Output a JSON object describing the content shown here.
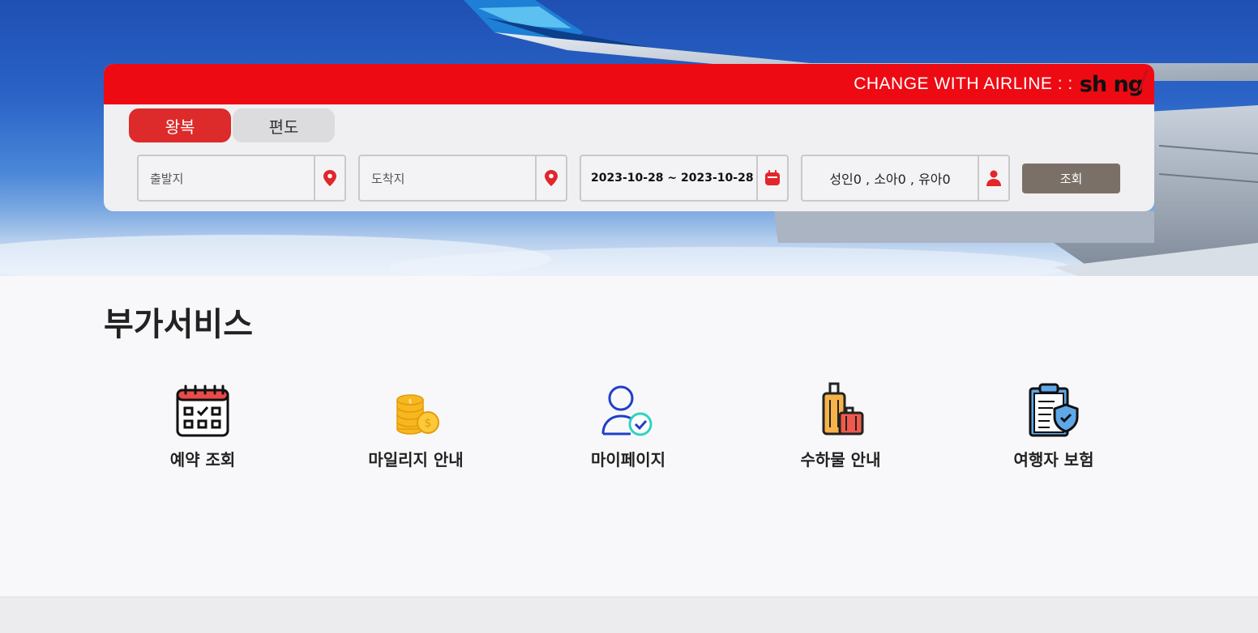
{
  "search_panel": {
    "tagline": "CHANGE WITH AIRLINE : :",
    "brand": "sh ng",
    "trip_types": {
      "round_trip": "왕복",
      "one_way": "편도",
      "selected": "round_trip"
    },
    "departure": {
      "placeholder": "출발지",
      "icon": "map-pin-icon"
    },
    "arrival": {
      "placeholder": "도착지",
      "icon": "map-pin-icon"
    },
    "dates": {
      "value": "2023-10-28 ~ 2023-10-28",
      "icon": "calendar-icon"
    },
    "passengers": {
      "value": "성인0 , 소아0 , 유아0",
      "icon": "person-icon"
    },
    "search_label": "조회"
  },
  "services": {
    "title": "부가서비스",
    "items": [
      {
        "label": "예약 조회",
        "icon": "calendar-check-icon"
      },
      {
        "label": "마일리지 안내",
        "icon": "coins-icon"
      },
      {
        "label": "마이페이지",
        "icon": "user-check-icon"
      },
      {
        "label": "수하물 안내",
        "icon": "luggage-icon"
      },
      {
        "label": "여행자 보험",
        "icon": "clipboard-shield-icon"
      }
    ]
  },
  "colors": {
    "accent": "#ee0a13",
    "active_tab": "#dd2a2a",
    "search_button": "#7b7067"
  }
}
